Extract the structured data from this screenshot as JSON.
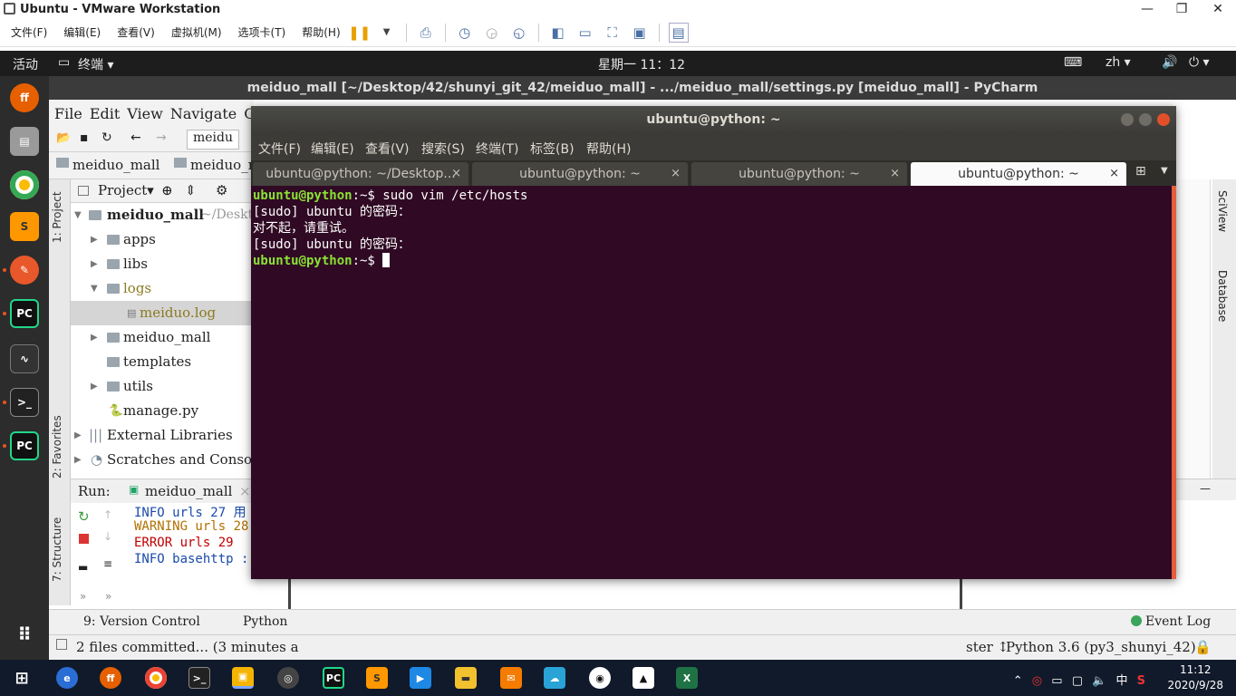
{
  "vmware": {
    "title": "Ubuntu - VMware Workstation",
    "menu": [
      "文件(F)",
      "编辑(E)",
      "查看(V)",
      "虚拟机(M)",
      "选项卡(T)",
      "帮助(H)"
    ],
    "win_min": "—",
    "win_max": "❐",
    "win_close": "✕"
  },
  "ubuntu_topbar": {
    "activities": "活动",
    "app_menu": "终端 ▾",
    "clock": "星期一 11：12",
    "input_method": "zh ▾",
    "volume": "🔊",
    "power": "⏻ ▾",
    "keyboard": "⌨"
  },
  "pycharm": {
    "title": "meiduo_mall [~/Desktop/42/shunyi_git_42/meiduo_mall] - .../meiduo_mall/settings.py [meiduo_mall] - PyCharm",
    "menu": [
      "File",
      "Edit",
      "View",
      "Navigate",
      "Coc"
    ],
    "toolbar_file": "meidu",
    "breadcrumb": [
      "meiduo_mall",
      "meiduo_m"
    ],
    "left_tabs": [
      "1: Project",
      "2: Favorites",
      "7: Structure"
    ],
    "project_header": "Project▾",
    "tree": [
      {
        "label": "meiduo_mall",
        "suffix": "~/Deskt",
        "type": "root"
      },
      {
        "label": "apps",
        "type": "folder"
      },
      {
        "label": "libs",
        "type": "folder"
      },
      {
        "label": "logs",
        "type": "folder-open"
      },
      {
        "label": "meiduo.log",
        "type": "file-selected"
      },
      {
        "label": "meiduo_mall",
        "type": "folder"
      },
      {
        "label": "templates",
        "type": "folder-plain"
      },
      {
        "label": "utils",
        "type": "folder"
      },
      {
        "label": "manage.py",
        "type": "pyfile"
      },
      {
        "label": "External Libraries",
        "type": "lib"
      },
      {
        "label": "Scratches and Console",
        "type": "scratch"
      }
    ],
    "run_label": "Run:",
    "run_tab": "meiduo_mall",
    "run_close": "×",
    "run_log": [
      "INFO urls 27 用",
      "WARNING urls 28",
      "ERROR urls 29 ",
      "INFO basehttp :"
    ],
    "bottom_tabs": [
      "9: Version Control",
      "Python",
      "Event Log"
    ],
    "status_left": "2 files committed... (3 minutes a",
    "status_right_prefix": "ster ↕",
    "status_interpreter": "Python 3.6 (py3_shunyi_42)",
    "right_tabs": [
      "SciView",
      "Database"
    ]
  },
  "terminal": {
    "title": "ubuntu@python: ~",
    "menu": [
      "文件(F)",
      "编辑(E)",
      "查看(V)",
      "搜索(S)",
      "终端(T)",
      "标签(B)",
      "帮助(H)"
    ],
    "tabs": [
      "ubuntu@python: ~/Desktop...",
      "ubuntu@python: ~",
      "ubuntu@python: ~",
      "ubuntu@python: ~"
    ],
    "tab_close": "×",
    "active_tab": 3,
    "lines": [
      {
        "prompt": "ubuntu@python",
        "rest": ":~$ sudo vim /etc/hosts"
      },
      {
        "text": "[sudo] ubuntu 的密码："
      },
      {
        "text": "对不起，请重试。"
      },
      {
        "text": "[sudo] ubuntu 的密码："
      },
      {
        "prompt": "ubuntu@python",
        "rest": ":~$ "
      }
    ]
  },
  "taskbar": {
    "time": "11:12",
    "date": "2020/9/28",
    "ime": "中"
  }
}
